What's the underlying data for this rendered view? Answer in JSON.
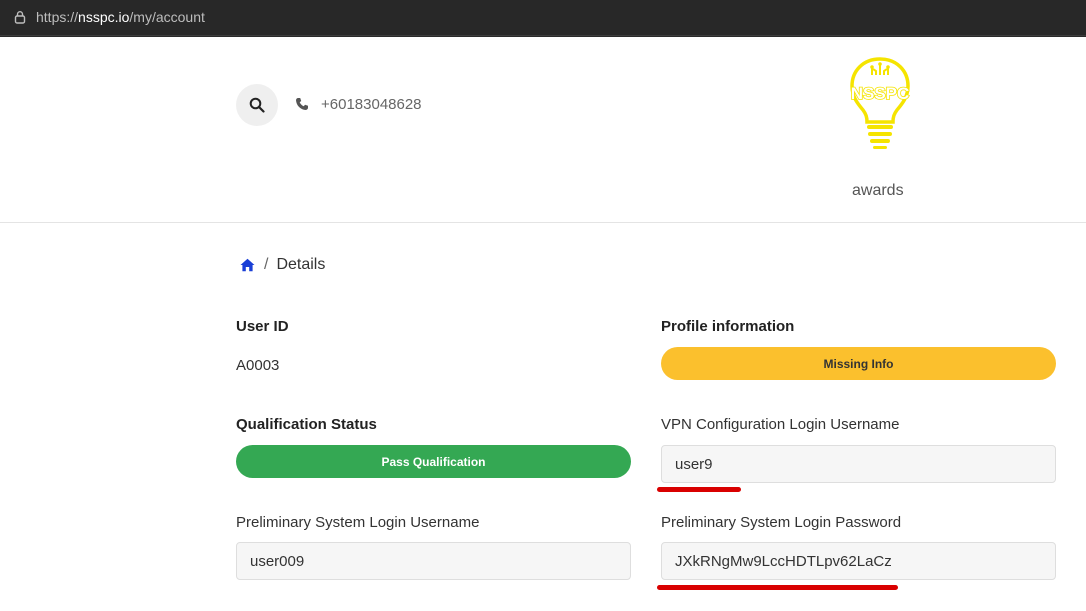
{
  "browser": {
    "url_scheme": "https://",
    "url_host": "nsspc.io",
    "url_path": "/my/account"
  },
  "header": {
    "phone": "+60183048628",
    "logo_text": "NSSPC",
    "nav_awards": "awards"
  },
  "breadcrumb": {
    "current": "Details"
  },
  "account": {
    "user_id_label": "User ID",
    "user_id_value": "A0003",
    "profile_label": "Profile information",
    "profile_status": "Missing Info",
    "qualification_label": "Qualification Status",
    "qualification_status": "Pass Qualification",
    "vpn_username_label": "VPN Configuration Login Username",
    "vpn_username_value": "user9",
    "prelim_username_label": "Preliminary System Login Username",
    "prelim_username_value": "user009",
    "prelim_password_label": "Preliminary System Login Password",
    "prelim_password_value": "JXkRNgMw9LccHDTLpv62LaCz"
  },
  "colors": {
    "pass": "#34a853",
    "missing": "#fbc02d",
    "annotation": "#d90000",
    "logo": "#f5e400",
    "home_icon": "#1a3fd6"
  },
  "icons": [
    "lock-icon",
    "search-icon",
    "phone-icon",
    "home-icon",
    "lightbulb-logo"
  ]
}
